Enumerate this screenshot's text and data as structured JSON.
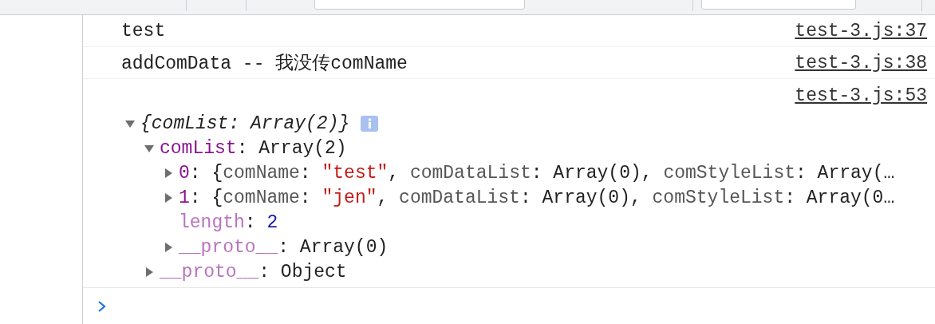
{
  "messages": [
    {
      "kind": "log",
      "text": "test",
      "source": "test-3.js:37"
    },
    {
      "kind": "log",
      "text": "addComData -- 我没传comName",
      "source": "test-3.js:38"
    },
    {
      "kind": "object",
      "source": "test-3.js:53",
      "tree": {
        "expanded": true,
        "info": true,
        "value": [
          {
            "kind": "italic",
            "text": "{comList: Array(2)}"
          }
        ],
        "children": [
          {
            "key": "comList",
            "dim": false,
            "expanded": true,
            "value": [
              {
                "kind": "plain",
                "text": ": Array(2)"
              }
            ],
            "children": [
              {
                "key": "0",
                "dim": false,
                "expanded": false,
                "value": [
                  {
                    "kind": "plain",
                    "text": ": {"
                  },
                  {
                    "kind": "prop",
                    "text": "comName"
                  },
                  {
                    "kind": "plain",
                    "text": ": "
                  },
                  {
                    "kind": "string",
                    "text": "\"test\""
                  },
                  {
                    "kind": "plain",
                    "text": ", "
                  },
                  {
                    "kind": "prop",
                    "text": "comDataList"
                  },
                  {
                    "kind": "plain",
                    "text": ": Array(0), "
                  },
                  {
                    "kind": "prop",
                    "text": "comStyleList"
                  },
                  {
                    "kind": "plain",
                    "text": ": Array(…"
                  }
                ]
              },
              {
                "key": "1",
                "dim": false,
                "expanded": false,
                "value": [
                  {
                    "kind": "plain",
                    "text": ": {"
                  },
                  {
                    "kind": "prop",
                    "text": "comName"
                  },
                  {
                    "kind": "plain",
                    "text": ": "
                  },
                  {
                    "kind": "string",
                    "text": "\"jen\""
                  },
                  {
                    "kind": "plain",
                    "text": ", "
                  },
                  {
                    "kind": "prop",
                    "text": "comDataList"
                  },
                  {
                    "kind": "plain",
                    "text": ": Array(0), "
                  },
                  {
                    "kind": "prop",
                    "text": "comStyleList"
                  },
                  {
                    "kind": "plain",
                    "text": ": Array(0…"
                  }
                ]
              },
              {
                "key": "length",
                "dim": true,
                "value": [
                  {
                    "kind": "plain",
                    "text": ": "
                  },
                  {
                    "kind": "number",
                    "text": "2"
                  }
                ]
              },
              {
                "key": "__proto__",
                "dim": true,
                "expanded": false,
                "value": [
                  {
                    "kind": "plain",
                    "text": ": Array(0)"
                  }
                ]
              }
            ]
          },
          {
            "key": "__proto__",
            "dim": true,
            "expanded": false,
            "value": [
              {
                "kind": "plain",
                "text": ": Object"
              }
            ]
          }
        ]
      }
    }
  ]
}
